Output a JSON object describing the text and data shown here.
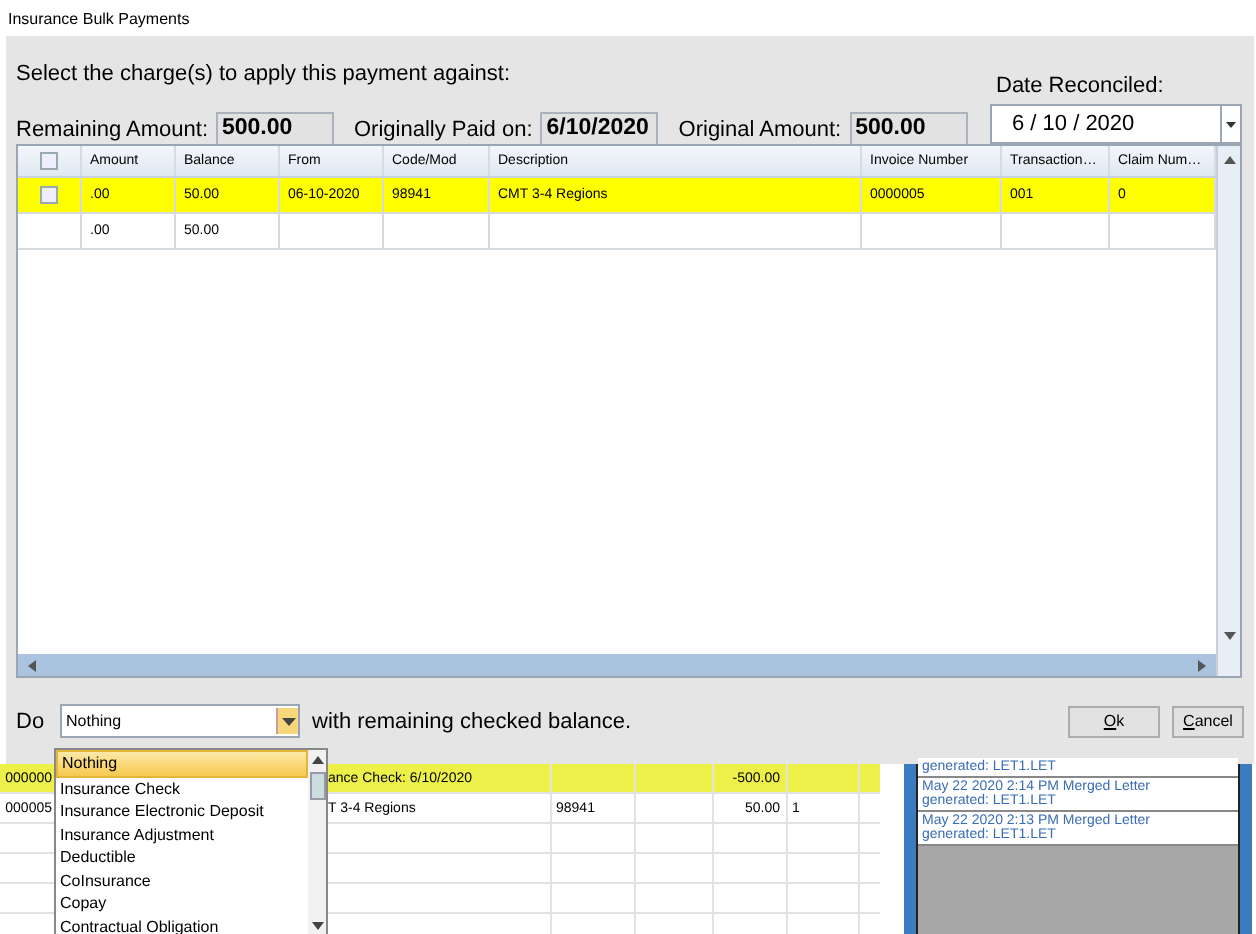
{
  "window": {
    "title": "Insurance Bulk Payments"
  },
  "prompt": "Select the charge(s) to apply this payment against:",
  "fields": [
    {
      "label": "Remaining Amount:",
      "value": "500.00"
    },
    {
      "label": "Originally Paid on:",
      "value": "6/10/2020"
    },
    {
      "label": "Original Amount:",
      "value": "500.00"
    }
  ],
  "date": {
    "label": "Date Reconciled:",
    "value": "6 / 10 / 2020"
  },
  "table": {
    "header_checked": false,
    "columns": [
      "Amount",
      "Balance",
      "From",
      "Code/Mod",
      "Description",
      "Invoice Number",
      "Transaction…",
      "Claim  Num…"
    ],
    "rows": [
      {
        "selected": true,
        "checked": false,
        "cells": [
          ".00",
          "50.00",
          "06-10-2020",
          "98941",
          "CMT 3-4 Regions",
          "0000005",
          "001",
          "0"
        ]
      },
      {
        "selected": false,
        "cells": [
          ".00",
          "50.00",
          "",
          "",
          "",
          "",
          "",
          ""
        ]
      }
    ]
  },
  "action": {
    "prefix": "Do",
    "value": "Nothing",
    "suffix": "with remaining checked balance.",
    "options": [
      {
        "label": "Nothing",
        "selected": true
      },
      {
        "label": "Insurance Check",
        "selected": false
      },
      {
        "label": "Insurance Electronic Deposit",
        "selected": false
      },
      {
        "label": "Insurance Adjustment",
        "selected": false
      },
      {
        "label": "Deductible",
        "selected": false
      },
      {
        "label": "CoInsurance",
        "selected": false
      },
      {
        "label": "Copay",
        "selected": false
      },
      {
        "label": "Contractual Obligation",
        "selected": false
      }
    ]
  },
  "buttons": [
    {
      "label": "Ok"
    },
    {
      "label": "Cancel"
    }
  ],
  "background": {
    "rows": [
      {
        "selected": true,
        "cells": [
          "000000",
          "ance Check: 6/10/2020",
          "",
          "",
          "-500.00",
          ""
        ]
      },
      {
        "selected": false,
        "cells": [
          "000005",
          "T 3-4 Regions",
          "98941",
          "",
          "50.00",
          "1"
        ]
      }
    ],
    "notes": [
      {
        "line2": "generated: LET1.LET"
      },
      {
        "line1": "May 22 2020 2:14 PM Merged Letter",
        "line2": "generated: LET1.LET"
      },
      {
        "line1": "May 22 2020 2:13 PM Merged Letter",
        "line2": "generated: LET1.LET"
      }
    ]
  }
}
